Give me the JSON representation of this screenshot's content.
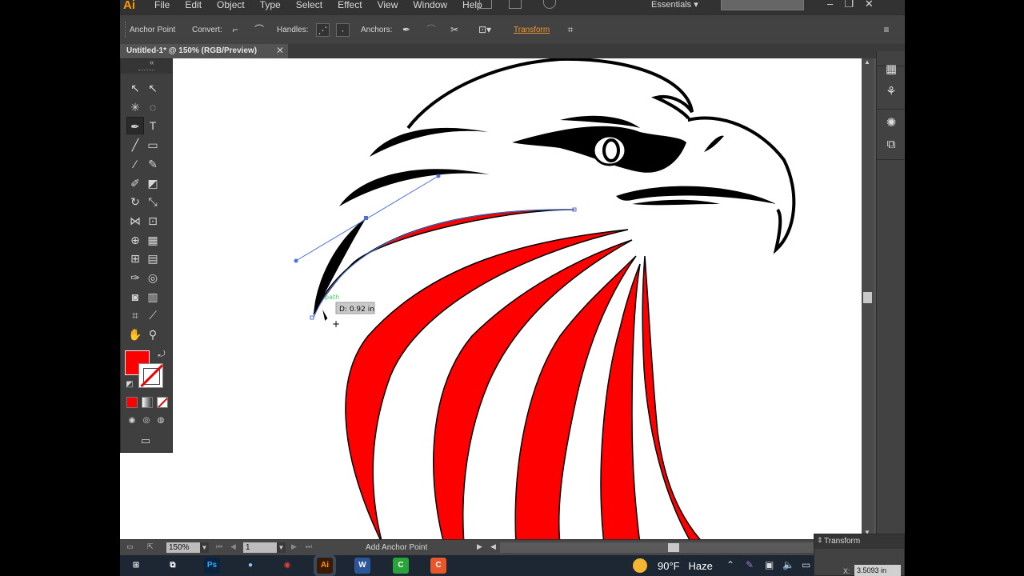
{
  "app": {
    "logo": "Ai",
    "menus": [
      "File",
      "Edit",
      "Object",
      "Type",
      "Select",
      "Effect",
      "View",
      "Window",
      "Help"
    ],
    "workspace": "Essentials",
    "window_buttons": [
      "–",
      "❐",
      "✕"
    ]
  },
  "control_bar": {
    "tool_name": "Anchor Point",
    "convert_label": "Convert:",
    "handles_label": "Handles:",
    "anchors_label": "Anchors:",
    "transform_link": "Transform"
  },
  "document": {
    "tab_title": "Untitled-1* @ 150% (RGB/Preview)",
    "close": "✕"
  },
  "canvas": {
    "tooltip": "D: 0.92 in",
    "smart_guide_label": "path",
    "colors": {
      "red": "#ff0000",
      "black": "#000000",
      "path_blue": "#4a6fd8"
    }
  },
  "tools": [
    {
      "name": "selection-tool",
      "glyph": "↖"
    },
    {
      "name": "direct-selection-tool",
      "glyph": "↖"
    },
    {
      "name": "magic-wand-tool",
      "glyph": "✳"
    },
    {
      "name": "lasso-tool",
      "glyph": "◌"
    },
    {
      "name": "pen-tool",
      "glyph": "✒"
    },
    {
      "name": "type-tool",
      "glyph": "T"
    },
    {
      "name": "line-segment-tool",
      "glyph": "╱"
    },
    {
      "name": "rectangle-tool",
      "glyph": "▭"
    },
    {
      "name": "paintbrush-tool",
      "glyph": "∕"
    },
    {
      "name": "pencil-tool",
      "glyph": "✎"
    },
    {
      "name": "blob-brush-tool",
      "glyph": "✐"
    },
    {
      "name": "eraser-tool",
      "glyph": "◩"
    },
    {
      "name": "rotate-tool",
      "glyph": "↻"
    },
    {
      "name": "scale-tool",
      "glyph": "⤡"
    },
    {
      "name": "width-tool",
      "glyph": "⋈"
    },
    {
      "name": "free-transform-tool",
      "glyph": "⊡"
    },
    {
      "name": "shape-builder-tool",
      "glyph": "⊕"
    },
    {
      "name": "perspective-grid-tool",
      "glyph": "▦"
    },
    {
      "name": "mesh-tool",
      "glyph": "⊞"
    },
    {
      "name": "gradient-tool",
      "glyph": "▤"
    },
    {
      "name": "eyedropper-tool",
      "glyph": "✑"
    },
    {
      "name": "blend-tool",
      "glyph": "◎"
    },
    {
      "name": "symbol-sprayer-tool",
      "glyph": "◙"
    },
    {
      "name": "column-graph-tool",
      "glyph": "▥"
    },
    {
      "name": "artboard-tool",
      "glyph": "⌗"
    },
    {
      "name": "slice-tool",
      "glyph": "⟋"
    },
    {
      "name": "hand-tool",
      "glyph": "✋"
    },
    {
      "name": "zoom-tool",
      "glyph": "⚲"
    }
  ],
  "colors": {
    "fill": "#ff0000",
    "stroke_none": "#ffffff"
  },
  "status": {
    "zoom": "150%",
    "page": "1",
    "message": "Add Anchor Point"
  },
  "transform_panel": {
    "title": "Transform",
    "x_label": "X:",
    "x_value": "3.5093 in"
  },
  "taskbar": {
    "weather_temp": "90°F",
    "weather_text": "Haze",
    "apps": [
      {
        "name": "start-button",
        "glyph": "⊞",
        "bg": "transparent"
      },
      {
        "name": "task-view-button",
        "glyph": "⧉",
        "bg": "transparent"
      },
      {
        "name": "photoshop-app",
        "glyph": "Ps",
        "bg": "#0a2440"
      },
      {
        "name": "paint-app",
        "glyph": "●",
        "bg": "transparent"
      },
      {
        "name": "chrome-app",
        "glyph": "◉",
        "bg": "transparent"
      },
      {
        "name": "illustrator-app",
        "glyph": "Ai",
        "bg": "#3b1a00"
      },
      {
        "name": "word-app",
        "glyph": "W",
        "bg": "#2b579a"
      },
      {
        "name": "camtasia-app",
        "glyph": "C",
        "bg": "#27a33a"
      },
      {
        "name": "camtasia-recorder-app",
        "glyph": "C",
        "bg": "#e8572a"
      }
    ]
  }
}
